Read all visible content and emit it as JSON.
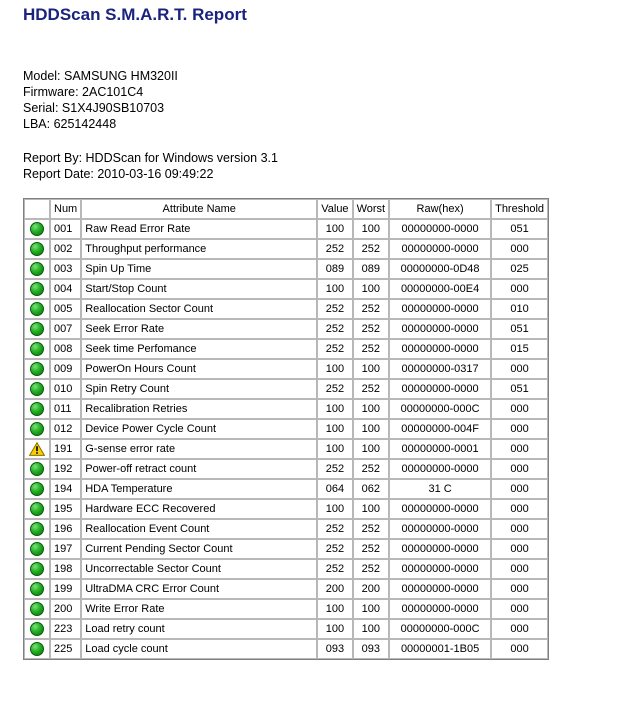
{
  "report": {
    "title": "HDDScan S.M.A.R.T. Report"
  },
  "device": {
    "model": "Model: SAMSUNG HM320II",
    "firmware": "Firmware: 2AC101C4",
    "serial": "Serial: S1X4J90SB10703",
    "lba": "LBA: 625142448"
  },
  "report_meta": {
    "by": "Report By: HDDScan for Windows version 3.1",
    "date": "Report Date: 2010-03-16 09:49:22"
  },
  "table": {
    "headers": {
      "num": "Num",
      "name": "Attribute Name",
      "value": "Value",
      "worst": "Worst",
      "raw": "Raw(hex)",
      "threshold": "Threshold"
    },
    "rows": [
      {
        "status": "ok",
        "icon": "status-ok-icon",
        "num": "001",
        "name": "Raw Read Error Rate",
        "value": "100",
        "worst": "100",
        "raw": "00000000-0000",
        "threshold": "051"
      },
      {
        "status": "ok",
        "icon": "status-ok-icon",
        "num": "002",
        "name": "Throughput performance",
        "value": "252",
        "worst": "252",
        "raw": "00000000-0000",
        "threshold": "000"
      },
      {
        "status": "ok",
        "icon": "status-ok-icon",
        "num": "003",
        "name": "Spin Up Time",
        "value": "089",
        "worst": "089",
        "raw": "00000000-0D48",
        "threshold": "025"
      },
      {
        "status": "ok",
        "icon": "status-ok-icon",
        "num": "004",
        "name": "Start/Stop Count",
        "value": "100",
        "worst": "100",
        "raw": "00000000-00E4",
        "threshold": "000"
      },
      {
        "status": "ok",
        "icon": "status-ok-icon",
        "num": "005",
        "name": "Reallocation Sector Count",
        "value": "252",
        "worst": "252",
        "raw": "00000000-0000",
        "threshold": "010"
      },
      {
        "status": "ok",
        "icon": "status-ok-icon",
        "num": "007",
        "name": "Seek Error Rate",
        "value": "252",
        "worst": "252",
        "raw": "00000000-0000",
        "threshold": "051"
      },
      {
        "status": "ok",
        "icon": "status-ok-icon",
        "num": "008",
        "name": "Seek time Perfomance",
        "value": "252",
        "worst": "252",
        "raw": "00000000-0000",
        "threshold": "015"
      },
      {
        "status": "ok",
        "icon": "status-ok-icon",
        "num": "009",
        "name": "PowerOn Hours Count",
        "value": "100",
        "worst": "100",
        "raw": "00000000-0317",
        "threshold": "000"
      },
      {
        "status": "ok",
        "icon": "status-ok-icon",
        "num": "010",
        "name": "Spin Retry Count",
        "value": "252",
        "worst": "252",
        "raw": "00000000-0000",
        "threshold": "051"
      },
      {
        "status": "ok",
        "icon": "status-ok-icon",
        "num": "011",
        "name": "Recalibration Retries",
        "value": "100",
        "worst": "100",
        "raw": "00000000-000C",
        "threshold": "000"
      },
      {
        "status": "ok",
        "icon": "status-ok-icon",
        "num": "012",
        "name": "Device Power Cycle Count",
        "value": "100",
        "worst": "100",
        "raw": "00000000-004F",
        "threshold": "000"
      },
      {
        "status": "warn",
        "icon": "warning-icon",
        "num": "191",
        "name": "G-sense error rate",
        "value": "100",
        "worst": "100",
        "raw": "00000000-0001",
        "threshold": "000"
      },
      {
        "status": "ok",
        "icon": "status-ok-icon",
        "num": "192",
        "name": "Power-off retract count",
        "value": "252",
        "worst": "252",
        "raw": "00000000-0000",
        "threshold": "000"
      },
      {
        "status": "ok",
        "icon": "status-ok-icon",
        "num": "194",
        "name": "HDA Temperature",
        "value": "064",
        "worst": "062",
        "raw": "31 C",
        "threshold": "000"
      },
      {
        "status": "ok",
        "icon": "status-ok-icon",
        "num": "195",
        "name": "Hardware ECC Recovered",
        "value": "100",
        "worst": "100",
        "raw": "00000000-0000",
        "threshold": "000"
      },
      {
        "status": "ok",
        "icon": "status-ok-icon",
        "num": "196",
        "name": "Reallocation Event Count",
        "value": "252",
        "worst": "252",
        "raw": "00000000-0000",
        "threshold": "000"
      },
      {
        "status": "ok",
        "icon": "status-ok-icon",
        "num": "197",
        "name": "Current Pending Sector Count",
        "value": "252",
        "worst": "252",
        "raw": "00000000-0000",
        "threshold": "000"
      },
      {
        "status": "ok",
        "icon": "status-ok-icon",
        "num": "198",
        "name": "Uncorrectable Sector Count",
        "value": "252",
        "worst": "252",
        "raw": "00000000-0000",
        "threshold": "000"
      },
      {
        "status": "ok",
        "icon": "status-ok-icon",
        "num": "199",
        "name": "UltraDMA CRC Error Count",
        "value": "200",
        "worst": "200",
        "raw": "00000000-0000",
        "threshold": "000"
      },
      {
        "status": "ok",
        "icon": "status-ok-icon",
        "num": "200",
        "name": "Write Error Rate",
        "value": "100",
        "worst": "100",
        "raw": "00000000-0000",
        "threshold": "000"
      },
      {
        "status": "ok",
        "icon": "status-ok-icon",
        "num": "223",
        "name": "Load retry count",
        "value": "100",
        "worst": "100",
        "raw": "00000000-000C",
        "threshold": "000"
      },
      {
        "status": "ok",
        "icon": "status-ok-icon",
        "num": "225",
        "name": "Load cycle count",
        "value": "093",
        "worst": "093",
        "raw": "00000001-1B05",
        "threshold": "000"
      }
    ]
  },
  "colors": {
    "title": "#1a237e",
    "ok": "#22b022",
    "warn": "#f5d000"
  }
}
